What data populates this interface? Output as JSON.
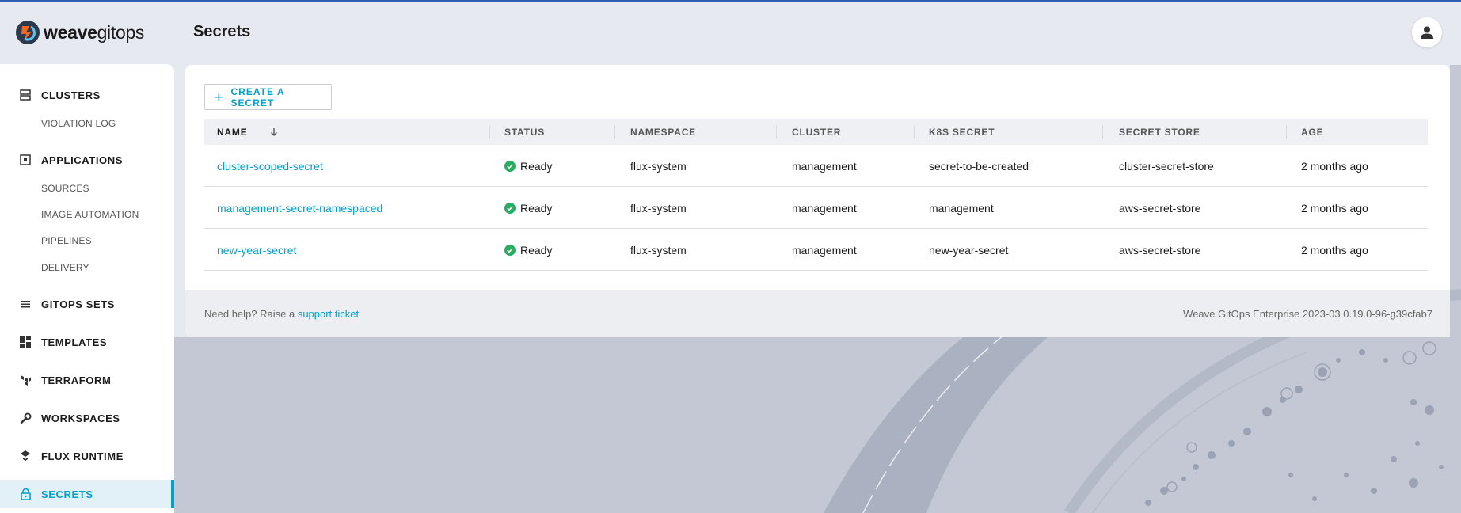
{
  "app": {
    "logo_bold": "weave",
    "logo_light": "gitops",
    "page_title": "Secrets"
  },
  "sidebar": {
    "items": [
      {
        "label": "CLUSTERS",
        "icon": "clusters-icon"
      },
      {
        "label": "APPLICATIONS",
        "icon": "applications-icon"
      },
      {
        "label": "GITOPS SETS",
        "icon": "gitops-sets-icon"
      },
      {
        "label": "TEMPLATES",
        "icon": "templates-icon"
      },
      {
        "label": "TERRAFORM",
        "icon": "terraform-icon"
      },
      {
        "label": "WORKSPACES",
        "icon": "wrench-icon"
      },
      {
        "label": "FLUX RUNTIME",
        "icon": "flux-icon"
      },
      {
        "label": "SECRETS",
        "icon": "lock-icon",
        "active": true
      }
    ],
    "subitems": {
      "violation_log": "VIOLATION LOG",
      "sources": "SOURCES",
      "image_automation": "IMAGE AUTOMATION",
      "pipelines": "PIPELINES",
      "delivery": "DELIVERY"
    }
  },
  "toolbar": {
    "create_label": "CREATE A SECRET"
  },
  "table": {
    "columns": [
      "NAME",
      "STATUS",
      "NAMESPACE",
      "CLUSTER",
      "K8S SECRET",
      "SECRET STORE",
      "AGE"
    ],
    "rows": [
      {
        "name": "cluster-scoped-secret",
        "status": "Ready",
        "namespace": "flux-system",
        "cluster": "management",
        "k8s_secret": "secret-to-be-created",
        "secret_store": "cluster-secret-store",
        "age": "2 months ago"
      },
      {
        "name": "management-secret-namespaced",
        "status": "Ready",
        "namespace": "flux-system",
        "cluster": "management",
        "k8s_secret": "management",
        "secret_store": "aws-secret-store",
        "age": "2 months ago"
      },
      {
        "name": "new-year-secret",
        "status": "Ready",
        "namespace": "flux-system",
        "cluster": "management",
        "k8s_secret": "new-year-secret",
        "secret_store": "aws-secret-store",
        "age": "2 months ago"
      }
    ]
  },
  "footer": {
    "help_prefix": "Need help? Raise a ",
    "help_link": "support ticket",
    "version": "Weave GitOps Enterprise 2023-03 0.19.0-96-g39cfab7"
  },
  "colors": {
    "accent": "#00a1cc",
    "ready": "#27ae60",
    "background": "#e6e9f0"
  }
}
